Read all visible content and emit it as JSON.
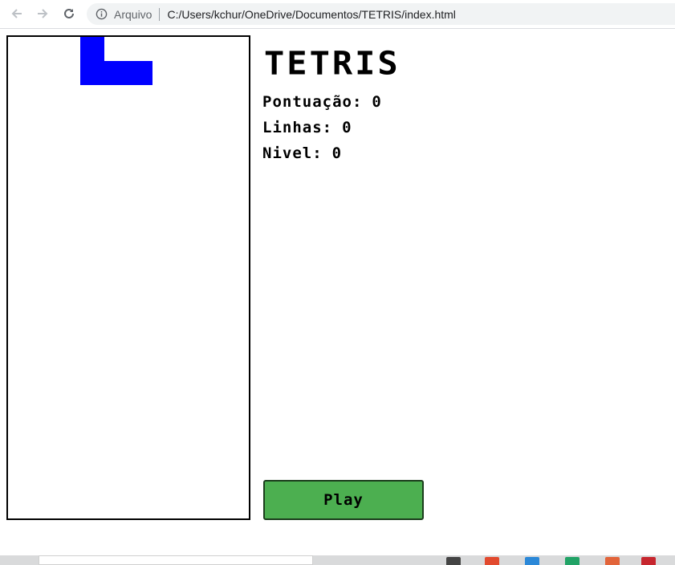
{
  "browser": {
    "scheme_label": "Arquivo",
    "url": "C:/Users/kchur/OneDrive/Documentos/TETRIS/index.html"
  },
  "game": {
    "title": "TETRIS",
    "stats": [
      {
        "label": "Pontuação:",
        "value": "0"
      },
      {
        "label": "Linhas:",
        "value": "0"
      },
      {
        "label": "Nivel:",
        "value": "0"
      }
    ],
    "play_label": "Play",
    "active_piece": {
      "type": "J",
      "color": "#0000ff",
      "cells": [
        [
          3,
          0
        ],
        [
          3,
          1
        ],
        [
          4,
          1
        ],
        [
          5,
          1
        ]
      ]
    },
    "colors": {
      "button": "#4caf50",
      "border": "#000000"
    }
  },
  "taskbar": {
    "app_colors": [
      "#444444",
      "#e24a2e",
      "#2b88d8",
      "#21a366",
      "#e2643a",
      "#c6262e"
    ]
  }
}
